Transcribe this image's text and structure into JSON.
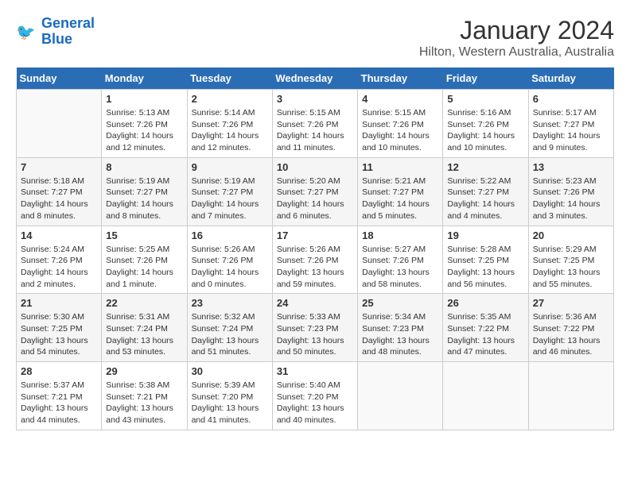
{
  "logo": {
    "line1": "General",
    "line2": "Blue"
  },
  "title": "January 2024",
  "subtitle": "Hilton, Western Australia, Australia",
  "days_of_week": [
    "Sunday",
    "Monday",
    "Tuesday",
    "Wednesday",
    "Thursday",
    "Friday",
    "Saturday"
  ],
  "weeks": [
    [
      {
        "day": "",
        "info": ""
      },
      {
        "day": "1",
        "info": "Sunrise: 5:13 AM\nSunset: 7:26 PM\nDaylight: 14 hours\nand 12 minutes."
      },
      {
        "day": "2",
        "info": "Sunrise: 5:14 AM\nSunset: 7:26 PM\nDaylight: 14 hours\nand 12 minutes."
      },
      {
        "day": "3",
        "info": "Sunrise: 5:15 AM\nSunset: 7:26 PM\nDaylight: 14 hours\nand 11 minutes."
      },
      {
        "day": "4",
        "info": "Sunrise: 5:15 AM\nSunset: 7:26 PM\nDaylight: 14 hours\nand 10 minutes."
      },
      {
        "day": "5",
        "info": "Sunrise: 5:16 AM\nSunset: 7:26 PM\nDaylight: 14 hours\nand 10 minutes."
      },
      {
        "day": "6",
        "info": "Sunrise: 5:17 AM\nSunset: 7:27 PM\nDaylight: 14 hours\nand 9 minutes."
      }
    ],
    [
      {
        "day": "7",
        "info": "Sunrise: 5:18 AM\nSunset: 7:27 PM\nDaylight: 14 hours\nand 8 minutes."
      },
      {
        "day": "8",
        "info": "Sunrise: 5:19 AM\nSunset: 7:27 PM\nDaylight: 14 hours\nand 8 minutes."
      },
      {
        "day": "9",
        "info": "Sunrise: 5:19 AM\nSunset: 7:27 PM\nDaylight: 14 hours\nand 7 minutes."
      },
      {
        "day": "10",
        "info": "Sunrise: 5:20 AM\nSunset: 7:27 PM\nDaylight: 14 hours\nand 6 minutes."
      },
      {
        "day": "11",
        "info": "Sunrise: 5:21 AM\nSunset: 7:27 PM\nDaylight: 14 hours\nand 5 minutes."
      },
      {
        "day": "12",
        "info": "Sunrise: 5:22 AM\nSunset: 7:27 PM\nDaylight: 14 hours\nand 4 minutes."
      },
      {
        "day": "13",
        "info": "Sunrise: 5:23 AM\nSunset: 7:26 PM\nDaylight: 14 hours\nand 3 minutes."
      }
    ],
    [
      {
        "day": "14",
        "info": "Sunrise: 5:24 AM\nSunset: 7:26 PM\nDaylight: 14 hours\nand 2 minutes."
      },
      {
        "day": "15",
        "info": "Sunrise: 5:25 AM\nSunset: 7:26 PM\nDaylight: 14 hours\nand 1 minute."
      },
      {
        "day": "16",
        "info": "Sunrise: 5:26 AM\nSunset: 7:26 PM\nDaylight: 14 hours\nand 0 minutes."
      },
      {
        "day": "17",
        "info": "Sunrise: 5:26 AM\nSunset: 7:26 PM\nDaylight: 13 hours\nand 59 minutes."
      },
      {
        "day": "18",
        "info": "Sunrise: 5:27 AM\nSunset: 7:26 PM\nDaylight: 13 hours\nand 58 minutes."
      },
      {
        "day": "19",
        "info": "Sunrise: 5:28 AM\nSunset: 7:25 PM\nDaylight: 13 hours\nand 56 minutes."
      },
      {
        "day": "20",
        "info": "Sunrise: 5:29 AM\nSunset: 7:25 PM\nDaylight: 13 hours\nand 55 minutes."
      }
    ],
    [
      {
        "day": "21",
        "info": "Sunrise: 5:30 AM\nSunset: 7:25 PM\nDaylight: 13 hours\nand 54 minutes."
      },
      {
        "day": "22",
        "info": "Sunrise: 5:31 AM\nSunset: 7:24 PM\nDaylight: 13 hours\nand 53 minutes."
      },
      {
        "day": "23",
        "info": "Sunrise: 5:32 AM\nSunset: 7:24 PM\nDaylight: 13 hours\nand 51 minutes."
      },
      {
        "day": "24",
        "info": "Sunrise: 5:33 AM\nSunset: 7:23 PM\nDaylight: 13 hours\nand 50 minutes."
      },
      {
        "day": "25",
        "info": "Sunrise: 5:34 AM\nSunset: 7:23 PM\nDaylight: 13 hours\nand 48 minutes."
      },
      {
        "day": "26",
        "info": "Sunrise: 5:35 AM\nSunset: 7:22 PM\nDaylight: 13 hours\nand 47 minutes."
      },
      {
        "day": "27",
        "info": "Sunrise: 5:36 AM\nSunset: 7:22 PM\nDaylight: 13 hours\nand 46 minutes."
      }
    ],
    [
      {
        "day": "28",
        "info": "Sunrise: 5:37 AM\nSunset: 7:21 PM\nDaylight: 13 hours\nand 44 minutes."
      },
      {
        "day": "29",
        "info": "Sunrise: 5:38 AM\nSunset: 7:21 PM\nDaylight: 13 hours\nand 43 minutes."
      },
      {
        "day": "30",
        "info": "Sunrise: 5:39 AM\nSunset: 7:20 PM\nDaylight: 13 hours\nand 41 minutes."
      },
      {
        "day": "31",
        "info": "Sunrise: 5:40 AM\nSunset: 7:20 PM\nDaylight: 13 hours\nand 40 minutes."
      },
      {
        "day": "",
        "info": ""
      },
      {
        "day": "",
        "info": ""
      },
      {
        "day": "",
        "info": ""
      }
    ]
  ]
}
